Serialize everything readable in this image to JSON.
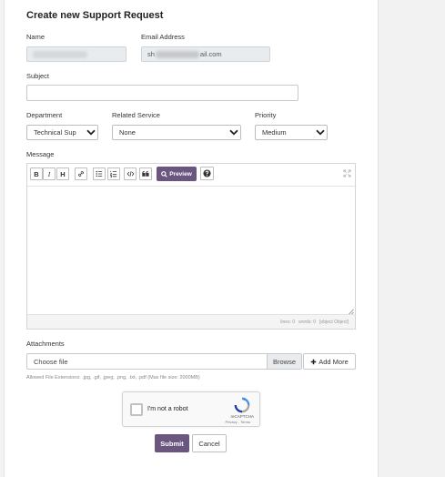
{
  "form": {
    "title": "Create new Support Request",
    "name_label": "Name",
    "email_label": "Email Address",
    "email_prefix": "sh",
    "email_suffix": "ail.com",
    "subject_label": "Subject",
    "subject_value": "",
    "department_label": "Department",
    "department_value": "Technical Sup",
    "related_service_label": "Related Service",
    "related_service_value": "None",
    "priority_label": "Priority",
    "priority_value": "Medium",
    "message_label": "Message"
  },
  "editor": {
    "toolbar": {
      "bold": "B",
      "italic": "I",
      "heading": "H",
      "preview": "Preview"
    },
    "status": {
      "lines": "lines: 0",
      "words": "words: 0",
      "object": "[object Object]"
    }
  },
  "attachments": {
    "label": "Attachments",
    "file_placeholder": "Choose file",
    "browse_label": "Browse",
    "add_more_label": "Add More",
    "hint": "Allowed File Extensions: .jpg, .gif, .jpeg, .png, .txt, .pdf (Max file size: 2000MB)"
  },
  "captcha": {
    "label": "I'm not a robot",
    "brand": "reCAPTCHA",
    "links": "Privacy - Terms"
  },
  "actions": {
    "submit_label": "Submit",
    "cancel_label": "Cancel"
  },
  "colors": {
    "primary": "#6b5680",
    "readonly_bg": "#e9ecef"
  },
  "icons": {
    "link": "link-icon",
    "bullet_list": "unordered-list-icon",
    "numbered_list": "ordered-list-icon",
    "code": "code-icon",
    "quote": "quote-icon",
    "preview": "search-icon",
    "help": "question-circle-icon",
    "fullscreen": "expand-icon",
    "add": "plus-icon"
  }
}
